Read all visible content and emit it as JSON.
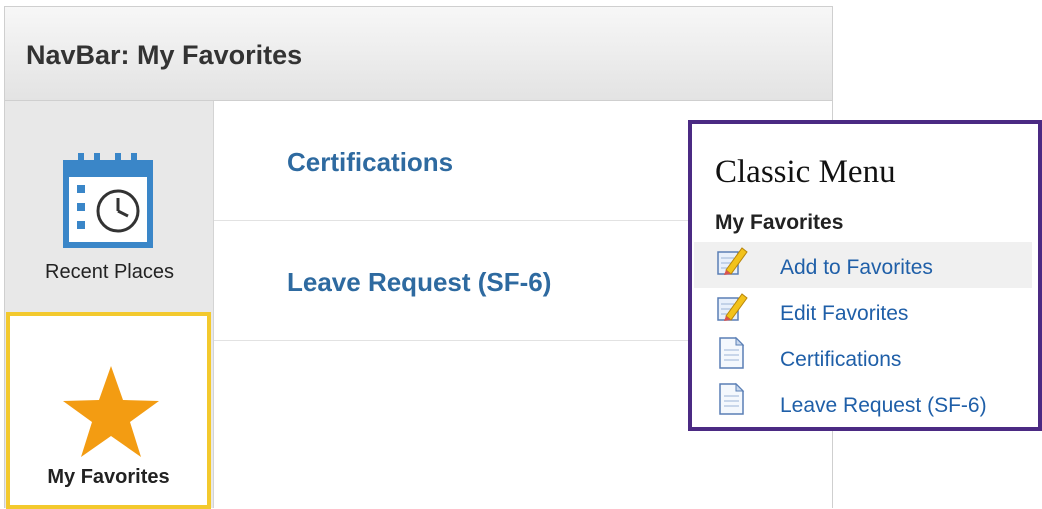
{
  "navbar": {
    "title": "NavBar: My Favorites",
    "sidebar": {
      "items": [
        {
          "label": "Recent Places",
          "icon": "calendar-clock-icon"
        },
        {
          "label": "My Favorites",
          "icon": "star-icon",
          "selected": true
        }
      ]
    },
    "favorites": [
      {
        "label": "Certifications"
      },
      {
        "label": "Leave Request (SF-6)"
      }
    ]
  },
  "classic_menu": {
    "title": "Classic Menu",
    "section": "My Favorites",
    "items": [
      {
        "label": "Add to Favorites",
        "icon": "pencil-notepad-icon"
      },
      {
        "label": "Edit Favorites",
        "icon": "pencil-notepad-icon"
      },
      {
        "label": "Certifications",
        "icon": "document-icon"
      },
      {
        "label": "Leave Request (SF-6)",
        "icon": "document-icon"
      }
    ]
  },
  "colors": {
    "link": "#2e6aa0",
    "selected_border": "#f3c92d",
    "callout_border": "#4b2a83",
    "star": "#f39c12",
    "calendar": "#3a86c8"
  }
}
